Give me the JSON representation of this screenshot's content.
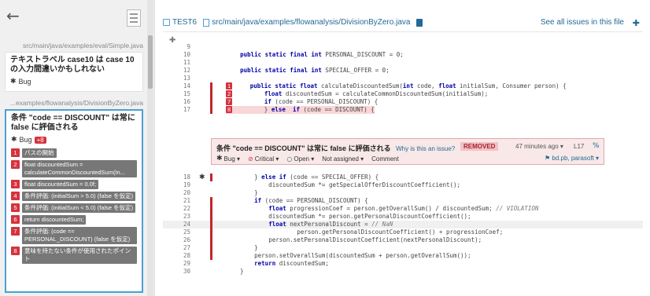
{
  "left_panel": {
    "back_icon": "←",
    "file1_path": "src/main/java/examples/eval/Simple.java",
    "issue1": {
      "title": "テキストラベル case10 は case 10 の入力間違いかもしれない",
      "type": "Bug"
    },
    "file2_path": "...examples/flowanalysis/DivisionByZero.java",
    "issue2": {
      "title": "条件 \"code == DISCOUNT\" は常に false に評価される",
      "type": "Bug",
      "flow_badge": "+8",
      "flows": [
        {
          "num": "1",
          "text": "パスの開始"
        },
        {
          "num": "2",
          "text": "float discountedSum = calculateCommonDiscountedSum(In..."
        },
        {
          "num": "3",
          "text": "float discountedSum = 0.0f;"
        },
        {
          "num": "4",
          "text": "条件評価: (initialSum > 5.0) (false を仮定)"
        },
        {
          "num": "5",
          "text": "条件評価: (initialSum < 5.0) (false を仮定)"
        },
        {
          "num": "6",
          "text": "return discountedSum;"
        },
        {
          "num": "7",
          "text": "条件評価: (code == PERSONAL_DISCOUNT) (false を仮定)"
        },
        {
          "num": "8",
          "text": "意味を持たない条件が使用されたポイント"
        }
      ]
    }
  },
  "header": {
    "project": "TEST6",
    "file_path": "src/main/java/examples/flowanalysis/DivisionByZero.java",
    "see_all": "See all issues in this file"
  },
  "code": {
    "lines_top": [
      {
        "n": "9",
        "t": ""
      },
      {
        "n": "10",
        "t": "    public static final int PERSONAL_DISCOUNT = 0;"
      },
      {
        "n": "11",
        "t": ""
      },
      {
        "n": "12",
        "t": "    public static final int SPECIAL_OFFER = 0;"
      },
      {
        "n": "13",
        "t": ""
      },
      {
        "n": "14",
        "t": "    public static float calculateDiscountedSum(int code, float initialSum, Consumer person) {"
      },
      {
        "n": "15",
        "t": "        float discountedSum = calculateCommonDiscountedSum(initialSum);"
      },
      {
        "n": "16",
        "t": "        if (code == PERSONAL_DISCOUNT) {"
      },
      {
        "n": "17",
        "t": "        } else  if (code == DISCOUNT) {"
      }
    ],
    "issue_markers": {
      "l14": "1",
      "l15": "2",
      "l16": "7",
      "l17": "8"
    },
    "lines_bottom": [
      {
        "n": "18",
        "t": "        } else if (code == SPECIAL_OFFER) {"
      },
      {
        "n": "19",
        "t": "            discountedSum *= getSpecialOfferDiscountCoefficient();"
      },
      {
        "n": "20",
        "t": "        }"
      },
      {
        "n": "21",
        "t": "        if (code == PERSONAL_DISCOUNT) {"
      },
      {
        "n": "22",
        "t": "            float progressionCoef = person.getOverallSum() / discountedSum; // VIOLATION"
      },
      {
        "n": "23",
        "t": "            discountedSum *= person.getPersonalDiscountCoefficient();"
      },
      {
        "n": "24",
        "t": "            float nextPersonalDiscount = // NaN"
      },
      {
        "n": "25",
        "t": "                    person.getPersonalDiscountCoefficient() + progressionCoef;"
      },
      {
        "n": "26",
        "t": "            person.setPersonalDiscountCoefficient(nextPersonalDiscount);"
      },
      {
        "n": "27",
        "t": "        }"
      },
      {
        "n": "28",
        "t": "        person.setOverallSum(discountedSum + person.getOverallSum());"
      },
      {
        "n": "29",
        "t": "        return discountedSum;"
      },
      {
        "n": "30",
        "t": "    }"
      }
    ]
  },
  "issue_box": {
    "title": "条件 \"code == DISCOUNT\" は常に false に評価される",
    "why": "Why is this an issue?",
    "status": "REMOVED",
    "age": "47 minutes ago ▾",
    "line": "L17",
    "type": "Bug ▾",
    "severity": "Critical ▾",
    "state": "Open ▾",
    "assignee": "Not assigned ▾",
    "comment": "Comment",
    "tags": "bd.pb, parasoft ▾"
  },
  "colors": {
    "accent": "#236a97",
    "issue_red": "#d4333f",
    "selected_border": "#4b9fd5"
  }
}
